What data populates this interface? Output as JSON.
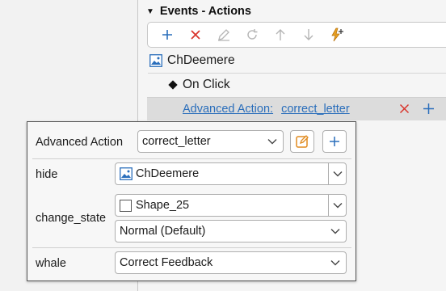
{
  "panel": {
    "header": "Events - Actions"
  },
  "toolbar": {
    "buttons": [
      "add-icon",
      "delete-icon",
      "edit-icon",
      "refresh-icon",
      "move-up-icon",
      "move-down-icon",
      "add-action-icon"
    ]
  },
  "tree": {
    "object_name": "ChDeemere",
    "event_name": "On Click",
    "action_prefix": "Advanced Action:",
    "action_name": "correct_letter"
  },
  "popup": {
    "advanced_action_label": "Advanced Action",
    "advanced_action_value": "correct_letter",
    "rows": {
      "hide": {
        "label": "hide",
        "value": "ChDeemere"
      },
      "change_state": {
        "label": "change_state",
        "object": "Shape_25",
        "state": "Normal (Default)"
      },
      "whale": {
        "label": "whale",
        "value": "Correct Feedback"
      }
    }
  },
  "colors": {
    "accent_blue": "#2a6ebb",
    "delete_red": "#d9342b",
    "edit_orange": "#e08a1e"
  }
}
